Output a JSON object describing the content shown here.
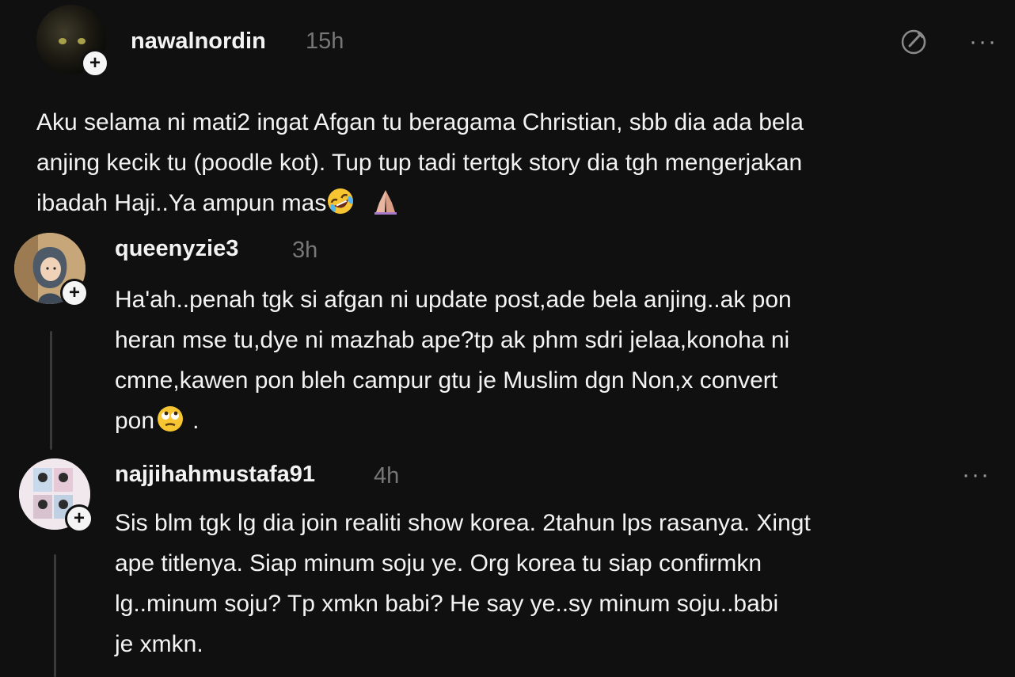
{
  "post": {
    "username": "nawalnordin",
    "time": "15h",
    "lines": [
      "Aku selama ni mati2 ingat Afgan tu beragama Christian, sbb dia ada bela",
      "anjing kecik tu (poodle kot). Tup tup tadi tertgk story dia tgh mengerjakan",
      "ibadah Haji..Ya ampun mas"
    ],
    "follow_symbol": "+",
    "more_label": "···"
  },
  "replies": [
    {
      "username": "queenyzie3",
      "time": "3h",
      "lines": [
        "Ha'ah..penah tgk si afgan ni update post,ade bela anjing..ak pon",
        "heran mse tu,dye ni mazhab ape?tp ak phm sdri jelaa,konoha ni",
        "cmne,kawen pon bleh campur gtu je Muslim dgn Non,x convert",
        "pon"
      ],
      "tail": ".",
      "follow_symbol": "+"
    },
    {
      "username": "najjihahmustafa91",
      "time": "4h",
      "lines": [
        "Sis blm tgk lg dia join realiti show korea. 2tahun lps rasanya. Xingt",
        "ape titlenya. Siap minum soju ye. Org korea tu siap confirmkn",
        "lg..minum soju? Tp xmkn babi? He say ye..sy minum soju..babi",
        "je xmkn."
      ],
      "follow_symbol": "+",
      "more_label": "···"
    }
  ],
  "icons": {
    "post_emojis": [
      "rolling-on-floor-laughing-emoji",
      "folded-hands-emoji"
    ],
    "reply_emoji": "face-with-rolling-eyes-emoji",
    "top_action": "edit-circle-icon"
  },
  "colors": {
    "background": "#101010",
    "text": "#f3f3f3",
    "muted": "#777777",
    "thread_line": "#3a3a3a"
  }
}
